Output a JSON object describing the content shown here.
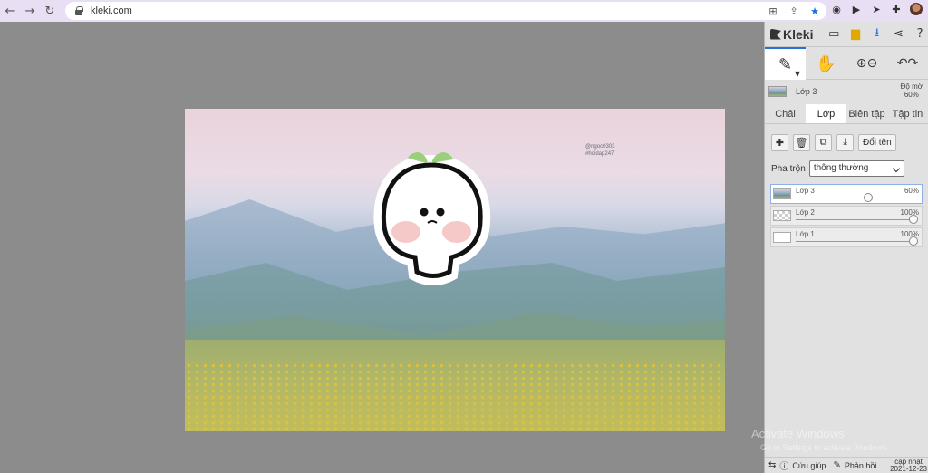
{
  "browser": {
    "url": "kleki.com",
    "nav": {
      "back_icon": "←",
      "forward_icon": "→",
      "reload_icon": "↻"
    }
  },
  "canvas": {
    "watermark_line1": "@ngoc0303",
    "watermark_line2": "#hoidap247"
  },
  "app": {
    "name": "Kleki",
    "layer_info": {
      "name": "Lớp 3",
      "opacity_label": "Độ mờ",
      "opacity_value": "60%"
    },
    "tabs": [
      "Chải",
      "Lớp",
      "Biên tập",
      "Tập tin"
    ],
    "active_tab": "Lớp",
    "rename_label": "Đổi tên",
    "blend": {
      "label": "Pha trộn",
      "value": "thông thường"
    },
    "layers": [
      {
        "name": "Lớp 3",
        "opacity": "60%",
        "opacity_value": 0.6
      },
      {
        "name": "Lớp 2",
        "opacity": "100%",
        "opacity_value": 1.0
      },
      {
        "name": "Lớp 1",
        "opacity": "100%",
        "opacity_value": 1.0
      }
    ],
    "bottom": {
      "help": "Cứu giúp",
      "feedback": "Phản hồi",
      "update_line1": "cập nhật",
      "update_line2": "2021-12-23"
    }
  },
  "os_watermark": {
    "title": "Activate Windows",
    "subtitle": "Go to Settings to activate Windows."
  }
}
